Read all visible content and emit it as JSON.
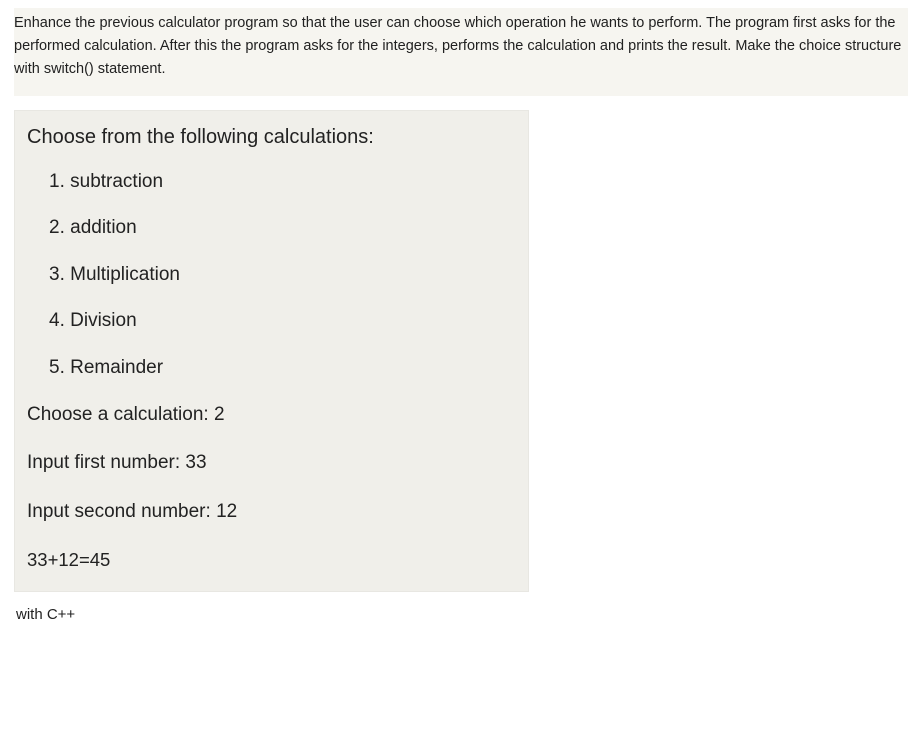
{
  "problem": {
    "text": "Enhance the previous calculator program so that the user can choose which operation he wants to perform. The program first asks for the performed calculation. After this the program asks for the integers, performs the calculation and prints the result. Make the choice structure with switch() statement."
  },
  "console": {
    "heading": "Choose from the following calculations:",
    "options": [
      "1. subtraction",
      "2. addition",
      "3. Multiplication",
      "4. Division",
      "5. Remainder"
    ],
    "prompts": {
      "choose": "Choose a calculation: 2",
      "first": "Input first number: 33",
      "second": "Input second number: 12"
    },
    "result": "33+12=45"
  },
  "footer_note": "with C++"
}
